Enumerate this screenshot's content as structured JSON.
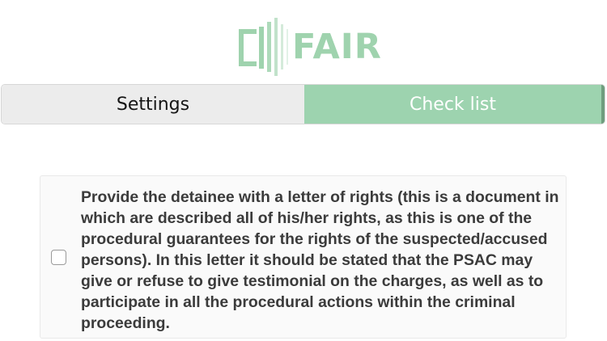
{
  "app": {
    "logo_text": "FAIR",
    "logo_icon": "fair-logo-mark"
  },
  "tabs": [
    {
      "label": "Settings",
      "selected": false
    },
    {
      "label": "Check list",
      "selected": true
    }
  ],
  "colors": {
    "accent": "#9dd3af",
    "tab_inactive_bg": "#ececec",
    "text": "#3b3b3b"
  },
  "checklist": {
    "items": [
      {
        "checked": false,
        "text": "Provide the detainee with a letter of rights (this is a document in which are described all of his/her rights, as this is one of the procedural guarantees for the rights of the suspected/accused persons). In this letter it should be stated that the PSAC may give or refuse to give testimonial on the charges, as well as to participate in all the procedural actions within the criminal proceeding."
      }
    ]
  }
}
